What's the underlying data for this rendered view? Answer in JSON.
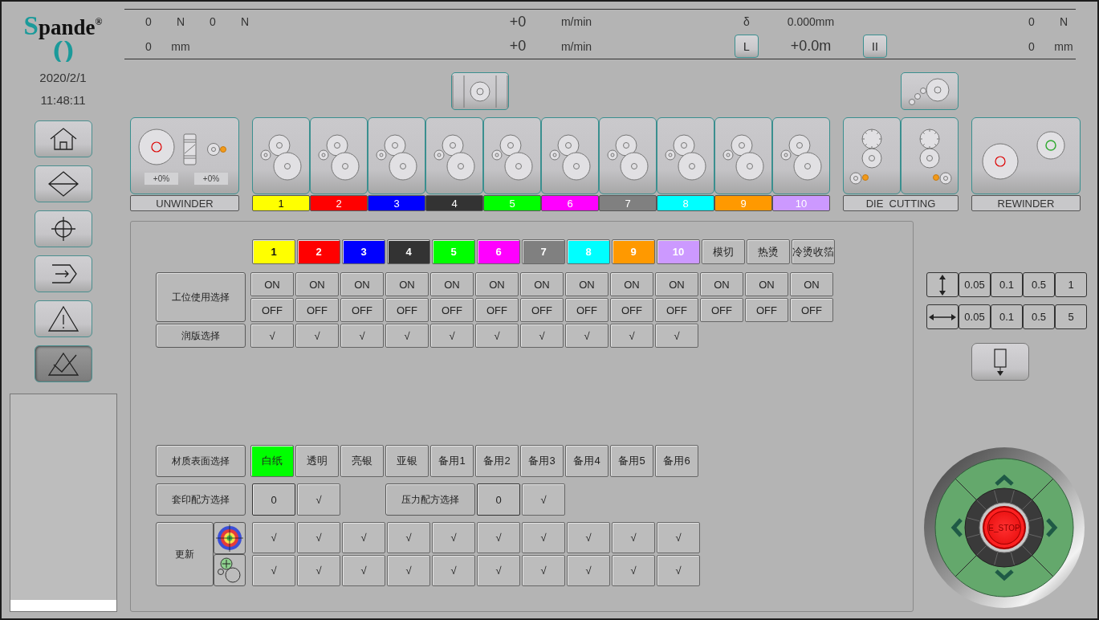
{
  "logo": {
    "text": "Spande",
    "mark": "®"
  },
  "date": "2020/2/1",
  "time": "11:48:11",
  "nav_buttons": [
    {
      "selected": false
    },
    {
      "selected": false
    },
    {
      "selected": false
    },
    {
      "selected": false
    },
    {
      "selected": false
    },
    {
      "selected": true
    }
  ],
  "header": [
    {
      "top": [
        {
          "kind": "text",
          "text": "0"
        },
        {
          "kind": "text",
          "text": "N"
        },
        {
          "kind": "text",
          "text": "0"
        },
        {
          "kind": "text",
          "text": "N"
        }
      ],
      "bottom": [
        {
          "kind": "text",
          "text": "0"
        },
        {
          "kind": "text",
          "text": "mm"
        }
      ]
    },
    {
      "top": [
        {
          "kind": "value",
          "text": "+0"
        },
        {
          "kind": "text",
          "text": "m/min"
        }
      ],
      "bottom": [
        {
          "kind": "value",
          "text": "+0"
        },
        {
          "kind": "text",
          "text": "m/min"
        }
      ]
    },
    {
      "top": [
        {
          "kind": "text",
          "text": "δ"
        },
        {
          "kind": "text",
          "text": "0.000mm"
        }
      ],
      "bottom": [
        {
          "kind": "button",
          "text": "L"
        },
        {
          "kind": "value",
          "text": "+0.0m"
        },
        {
          "kind": "button",
          "text": "II"
        }
      ]
    },
    {
      "top": [
        {
          "kind": "text",
          "text": "0"
        },
        {
          "kind": "text",
          "text": "N"
        }
      ],
      "bottom": [
        {
          "kind": "text",
          "text": "0"
        },
        {
          "kind": "text",
          "text": "mm"
        }
      ]
    }
  ],
  "units": [
    {
      "kind": "unwinder",
      "label": "UNWINDER",
      "readings": [
        "+0%",
        "+0%"
      ]
    },
    {
      "kind": "print",
      "label": "1",
      "color": "#ffff00"
    },
    {
      "kind": "print",
      "label": "2",
      "color": "#ff0000"
    },
    {
      "kind": "print",
      "label": "3",
      "color": "#0000ff"
    },
    {
      "kind": "print",
      "label": "4",
      "color": "#333333"
    },
    {
      "kind": "print",
      "label": "5",
      "color": "#00ff00"
    },
    {
      "kind": "print",
      "label": "6",
      "color": "#ff00ff"
    },
    {
      "kind": "print",
      "label": "7",
      "color": "#808080"
    },
    {
      "kind": "print",
      "label": "8",
      "color": "#00ffff"
    },
    {
      "kind": "print",
      "label": "9",
      "color": "#ff9900"
    },
    {
      "kind": "print",
      "label": "10",
      "color": "#cc99ff"
    },
    {
      "kind": "die_cutting",
      "label": "DIE  CUTTING"
    },
    {
      "kind": "rewinder",
      "label": "REWINDER"
    }
  ],
  "stations": {
    "columns": [
      {
        "label": "1",
        "color": "#ffff00"
      },
      {
        "label": "2",
        "color": "#ff0000"
      },
      {
        "label": "3",
        "color": "#0000ff"
      },
      {
        "label": "4",
        "color": "#333333"
      },
      {
        "label": "5",
        "color": "#00ff00"
      },
      {
        "label": "6",
        "color": "#ff00ff"
      },
      {
        "label": "7",
        "color": "#808080"
      },
      {
        "label": "8",
        "color": "#00ffff"
      },
      {
        "label": "9",
        "color": "#ff9900"
      },
      {
        "label": "10",
        "color": "#cc99ff"
      },
      {
        "label": "模切"
      },
      {
        "label": "热烫"
      },
      {
        "label": "冷烫收箔"
      }
    ],
    "use": {
      "label": "工位使用选择",
      "on": [
        "ON",
        "ON",
        "ON",
        "ON",
        "ON",
        "ON",
        "ON",
        "ON",
        "ON",
        "ON",
        "ON",
        "ON",
        "ON"
      ],
      "off": [
        "OFF",
        "OFF",
        "OFF",
        "OFF",
        "OFF",
        "OFF",
        "OFF",
        "OFF",
        "OFF",
        "OFF",
        "OFF",
        "OFF",
        "OFF"
      ]
    },
    "dampening": {
      "label": "润版选择",
      "cells": [
        "√",
        "√",
        "√",
        "√",
        "√",
        "√",
        "√",
        "√",
        "√",
        "√"
      ]
    }
  },
  "material": {
    "label": "材质表面选择",
    "options": [
      {
        "label": "白纸",
        "selected": true
      },
      {
        "label": "透明",
        "selected": false
      },
      {
        "label": "亮银",
        "selected": false
      },
      {
        "label": "亚银",
        "selected": false
      },
      {
        "label": "备用1",
        "selected": false
      },
      {
        "label": "备用2",
        "selected": false
      },
      {
        "label": "备用3",
        "selected": false
      },
      {
        "label": "备用4",
        "selected": false
      },
      {
        "label": "备用5",
        "selected": false
      },
      {
        "label": "备用6",
        "selected": false
      }
    ]
  },
  "register_recipe": {
    "label": "套印配方选择",
    "value": "0",
    "confirm": "√"
  },
  "pressure_recipe": {
    "label": "压力配方选择",
    "value": "0",
    "confirm": "√"
  },
  "update": {
    "label": "更新",
    "rows": [
      {
        "cells": [
          "√",
          "√",
          "√",
          "√",
          "√",
          "√",
          "√",
          "√",
          "√",
          "√"
        ]
      },
      {
        "cells": [
          "√",
          "√",
          "√",
          "√",
          "√",
          "√",
          "√",
          "√",
          "√",
          "√"
        ]
      }
    ]
  },
  "jog": {
    "rows": [
      {
        "kind": "vertical",
        "steps": [
          "0.05",
          "0.1",
          "0.5",
          "1"
        ]
      },
      {
        "kind": "horizontal",
        "steps": [
          "0.05",
          "0.1",
          "0.5",
          "5"
        ]
      }
    ]
  },
  "e_stop": "E_STOP"
}
